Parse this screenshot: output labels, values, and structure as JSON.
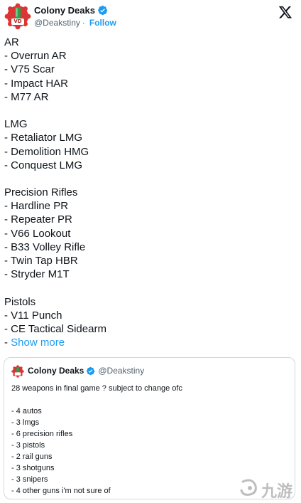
{
  "author": {
    "display_name": "Colony Deaks",
    "handle": "@Deakstiny",
    "follow_label": "Follow",
    "separator": "·",
    "avatar_text": "VD"
  },
  "icons": {
    "close": "x-logo-icon",
    "verified": "verified-badge-icon"
  },
  "colors": {
    "accent": "#1d9bf0",
    "text": "#0f1419",
    "muted": "#536471",
    "border": "#cfd9de"
  },
  "tweet": {
    "lines": [
      "AR",
      "- Overrun AR",
      "- V75 Scar",
      "- Impact HAR",
      "- M77 AR",
      "",
      "LMG",
      "- Retaliator LMG",
      "- Demolition HMG",
      "- Conquest LMG",
      "",
      "Precision Rifles",
      "- Hardline PR",
      "- Repeater PR",
      "- V66 Lookout",
      "- B33 Volley Rifle",
      "- Twin Tap HBR",
      "- Stryder M1T",
      "",
      "Pistols",
      "- V11 Punch",
      "- CE Tactical Sidearm"
    ],
    "show_more_prefix": "- ",
    "show_more_label": "Show more"
  },
  "quote": {
    "display_name": "Colony Deaks",
    "handle": "@Deakstiny",
    "lines": [
      "28 weapons in final game ? subject to change ofc",
      "",
      "- 4 autos",
      "- 3 lmgs",
      "- 6 precision rifles",
      "- 3 pistols",
      "- 2 rail guns",
      "- 3 shotguns",
      "- 3 snipers",
      "- 4 other guns i'm not sure of"
    ]
  },
  "watermark": {
    "text": "九游"
  }
}
